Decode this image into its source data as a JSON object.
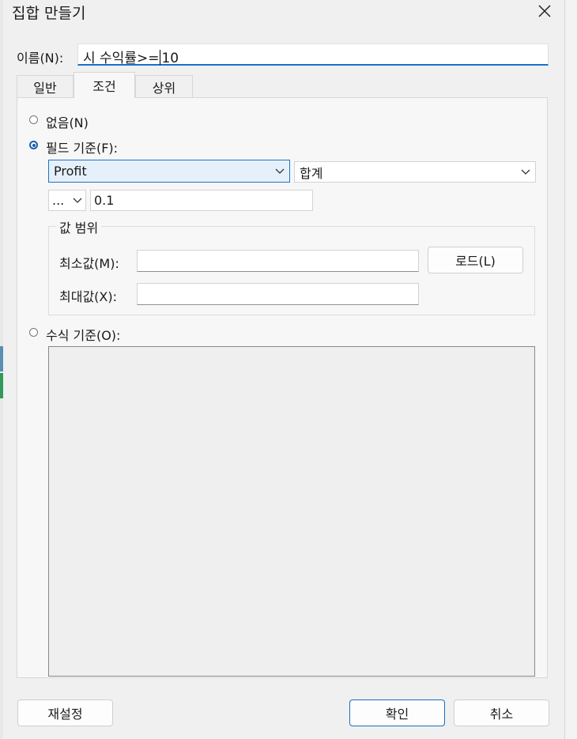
{
  "window": {
    "title": "집합 만들기",
    "close_icon": "close-icon"
  },
  "name": {
    "label": "이름(N):",
    "value_before_caret": "시 수익률>=",
    "value_after_caret": "10"
  },
  "tabs": [
    {
      "label": "일반",
      "active": false
    },
    {
      "label": "조건",
      "active": true
    },
    {
      "label": "상위",
      "active": false
    }
  ],
  "condition": {
    "none_label": "없음(N)",
    "by_field_label": "필드 기준(F):",
    "field_select": "Profit",
    "aggregation_select": "합계",
    "operator_select": "...",
    "value": "0.1",
    "range": {
      "title": "값 범위",
      "min_label": "최소값(M):",
      "min_value": "",
      "max_label": "최대값(X):",
      "max_value": "",
      "load_button": "로드(L)"
    },
    "by_formula_label": "수식 기준(O):",
    "formula_text": "",
    "selected_option": "by_field"
  },
  "footer": {
    "reset": "재설정",
    "ok": "확인",
    "cancel": "취소"
  },
  "colors": {
    "accent": "#1a5fb0",
    "focus": "#1f73c4",
    "background": "#f0f0f0"
  }
}
